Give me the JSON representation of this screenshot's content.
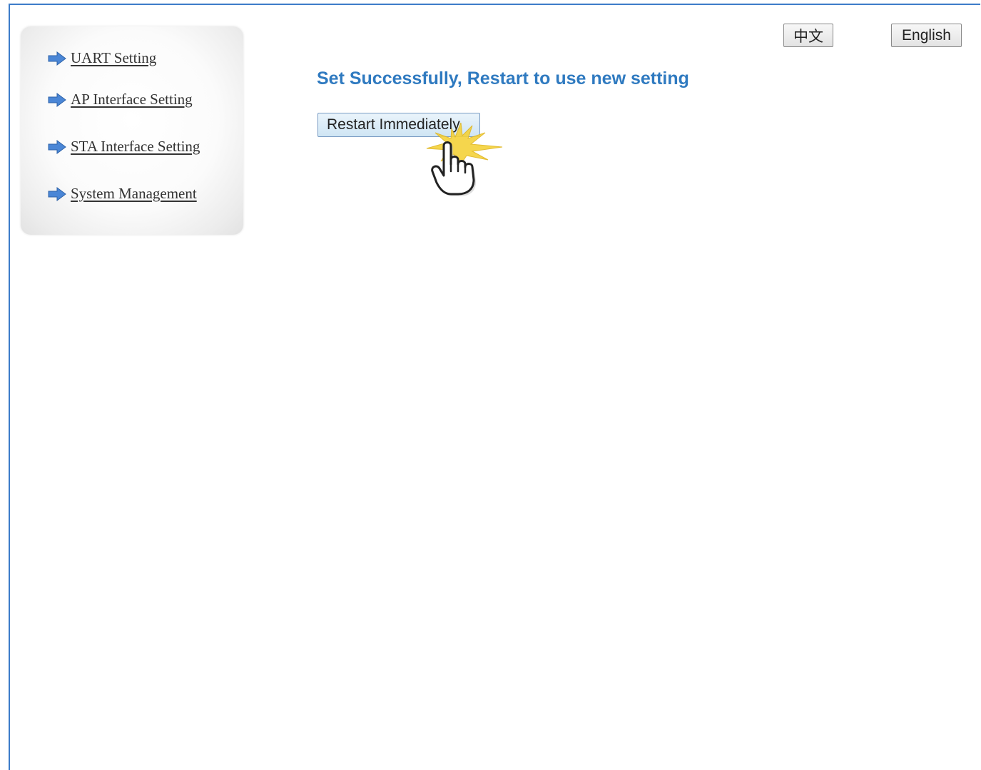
{
  "sidebar": {
    "items": [
      {
        "label": "UART Setting",
        "icon": "arrow-right-icon"
      },
      {
        "label": "AP Interface Setting",
        "icon": "arrow-right-icon"
      },
      {
        "label": "STA Interface Setting",
        "icon": "arrow-right-icon"
      },
      {
        "label": "System Management",
        "icon": "arrow-right-icon"
      }
    ]
  },
  "header": {
    "lang_chinese": "中文",
    "lang_english": "English"
  },
  "main": {
    "message": "Set Successfully, Restart to use new setting",
    "restart_label": "Restart Immediately",
    "cursor_icon": "hand-pointer-click-icon"
  },
  "colors": {
    "accent": "#3d7cc9",
    "message": "#2f7ac0",
    "arrow": "#4a86d6"
  }
}
